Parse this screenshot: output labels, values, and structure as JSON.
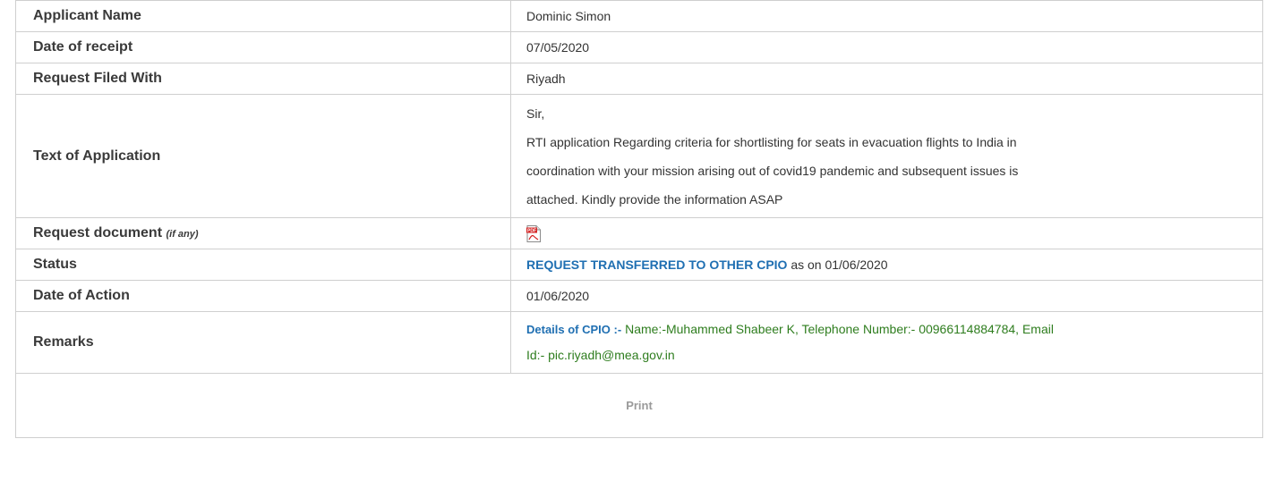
{
  "rows": {
    "applicant_name": {
      "label": "Applicant Name",
      "value": "Dominic Simon"
    },
    "date_of_receipt": {
      "label": "Date of receipt",
      "value": "07/05/2020"
    },
    "request_filed_with": {
      "label": "Request Filed With",
      "value": "Riyadh"
    },
    "text_of_application": {
      "label": "Text of Application",
      "lines": [
        "Sir,",
        "RTI application Regarding criteria for shortlisting for seats in evacuation flights to India in",
        "coordination with your mission arising out of covid19 pandemic and subsequent issues is",
        "attached. Kindly provide the information ASAP"
      ]
    },
    "request_document": {
      "label": "Request document",
      "note": "(if any)",
      "icon": "pdf-icon"
    },
    "status": {
      "label": "Status",
      "status_text": "REQUEST TRANSFERRED TO OTHER CPIO",
      "as_on": "as on 01/06/2020"
    },
    "date_of_action": {
      "label": "Date of Action",
      "value": "01/06/2020"
    },
    "remarks": {
      "label": "Remarks",
      "cpio_label": "Details of CPIO :-",
      "cpio_line1": "Name:-Muhammed Shabeer K, Telephone Number:- 00966114884784, Email",
      "cpio_line2": "Id:- pic.riyadh@mea.gov.in"
    }
  },
  "print_label": "Print",
  "colors": {
    "link_blue": "#1f6fb2",
    "remark_green": "#2e7d1e",
    "border": "#cfcfcf",
    "pdf_red": "#d42020"
  }
}
